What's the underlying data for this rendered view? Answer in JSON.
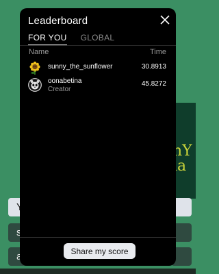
{
  "modal": {
    "title": "Leaderboard",
    "tabs": [
      {
        "label": "FOR YOU",
        "active": true
      },
      {
        "label": "GLOBAL",
        "active": false
      }
    ],
    "columns": {
      "name": "Name",
      "time": "Time"
    },
    "entries": [
      {
        "username": "sunny_the_sunflower",
        "subtitle": "",
        "time": "30.8913",
        "avatar_icon": "sunflower-icon"
      },
      {
        "username": "oonabetina",
        "subtitle": "Creator",
        "time": "45.8272",
        "avatar_icon": "panda-face-icon"
      }
    ],
    "share_label": "Share my score"
  },
  "background": {
    "pill_letters": [
      "Y",
      "s",
      "a"
    ],
    "scribble": "nY\nla"
  },
  "colors": {
    "page_background": "#3b8f63",
    "modal_background": "#000000",
    "share_button_background": "#e9ebef"
  }
}
